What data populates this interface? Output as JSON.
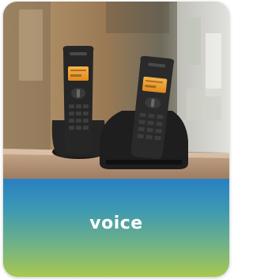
{
  "card": {
    "label": "voice",
    "image_name": "cordless-phones-photo"
  },
  "colors": {
    "band_top": "#2a7fc2",
    "band_bottom": "#a8c84f",
    "label_text": "#ffffff"
  }
}
